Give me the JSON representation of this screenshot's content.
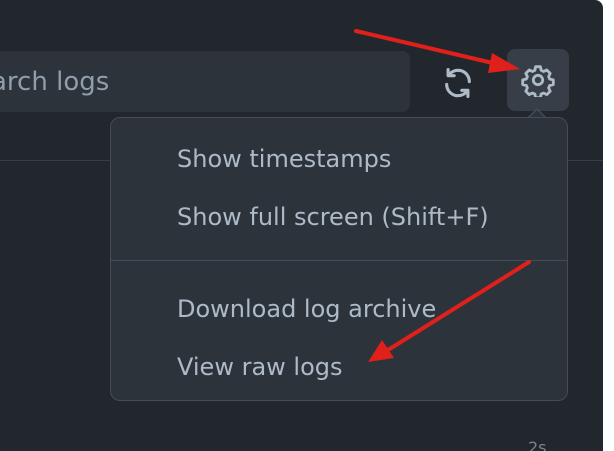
{
  "search": {
    "placeholder": "Search logs",
    "visible_text": "arch logs"
  },
  "toolbar": {
    "refresh_icon": "refresh-icon",
    "settings_icon": "gear-icon"
  },
  "settings_menu": {
    "groups": [
      {
        "items": [
          {
            "label": "Show timestamps"
          },
          {
            "label": "Show full screen (Shift+F)"
          }
        ]
      },
      {
        "items": [
          {
            "label": "Download log archive"
          },
          {
            "label": "View raw logs"
          }
        ]
      }
    ]
  },
  "footer": {
    "partial_text": "2s"
  },
  "colors": {
    "background": "#22272e",
    "surface": "#2d333b",
    "border": "#444c56",
    "text": "#adbac7",
    "muted_text": "#909dab",
    "annotation_arrow": "#e0201b"
  }
}
